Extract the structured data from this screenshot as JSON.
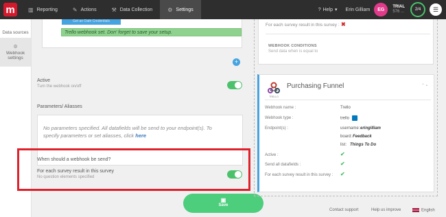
{
  "nav": {
    "logo": "m",
    "items": [
      {
        "label": "Reporting",
        "icon": "chart-icon"
      },
      {
        "label": "Actions",
        "icon": "edit-icon"
      },
      {
        "label": "Data Collection",
        "icon": "wrench-icon"
      },
      {
        "label": "Settings",
        "icon": "gear-icon"
      }
    ],
    "help": "Help",
    "user_name": "Erin Gilliam",
    "avatar_initials": "EG",
    "trial_label": "TRIAL",
    "trial_sub": "576 ...",
    "progress": "2/4"
  },
  "sidebar": {
    "items": [
      {
        "label": "Data sources"
      },
      {
        "label": "Webhook settings"
      }
    ]
  },
  "form": {
    "old_button": "Get an Oath Credentials",
    "banner": "Trello webhook set. Don' forget to save your setup.",
    "active_label": "Active",
    "active_sub": "Turn the webhook on/off",
    "params_label": "Parameters/ Aliasses",
    "params_text": "No parameters specified. All datafields will be send to your endpoint(s). To specify parameters or set aliasses, click",
    "params_link": "here",
    "when_label": "When should a webhook be send?",
    "each_label": "For each survey result in this survey",
    "each_sub": "No question elements specified",
    "save": "Save"
  },
  "preview_card": {
    "each_label": "For each survey result in this survey :",
    "conditions_title": "WEBHOOK CONDITIONS",
    "conditions_sub": "Send data when is equal to"
  },
  "pf_card": {
    "title": "Purchasing Funnel",
    "icon_label": "TRELLO",
    "rows": {
      "name_label": "Webhook name :",
      "name_value": "Trello",
      "type_label": "Webhook type :",
      "type_value": "trello",
      "endpoints_label": "Endpoint(s) :",
      "username_key": "username:",
      "username_val": "eringilliam",
      "board_key": "board:",
      "board_val": "Feedback",
      "list_key": "list:",
      "list_val": "Things To Do",
      "active_label": "Active :",
      "send_all_label": "Send all datafields :",
      "each_label": "For each survey result in this survey :"
    }
  },
  "footer": {
    "contact": "Contact support",
    "improve": "Help us improve",
    "language": "English"
  },
  "colors": {
    "accent": "#45a3e0",
    "success": "#4cc16c",
    "brand": "#d5192d",
    "highlight": "#e0202a"
  }
}
